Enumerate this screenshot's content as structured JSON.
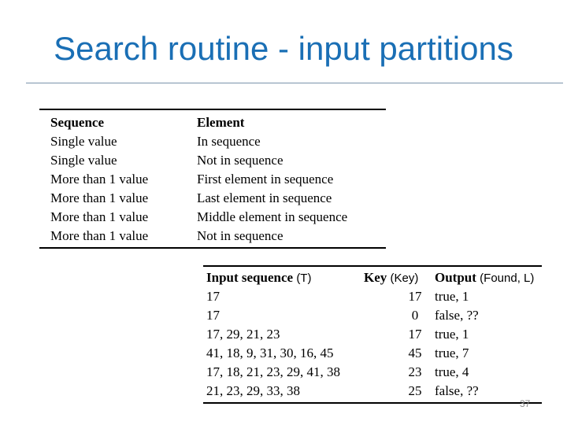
{
  "slide": {
    "title": "Search routine - input partitions",
    "page_number": "37"
  },
  "partitions_table": {
    "headers": [
      "Sequence",
      "Element"
    ],
    "rows": [
      [
        "Single value",
        "In sequence"
      ],
      [
        "Single value",
        "Not in sequence"
      ],
      [
        "More than 1 value",
        "First element in sequence"
      ],
      [
        "More than 1 value",
        "Last element in sequence"
      ],
      [
        "More than 1 value",
        "Middle element in sequence"
      ],
      [
        "More than 1 value",
        "Not in sequence"
      ]
    ]
  },
  "test_table": {
    "headers": [
      {
        "label": "Input sequence",
        "param": "(T)"
      },
      {
        "label": "Key",
        "param": "(Key)"
      },
      {
        "label": "Output",
        "param": "(Found, L)"
      }
    ],
    "rows": [
      [
        "17",
        "17",
        "true, 1"
      ],
      [
        "17",
        "0",
        "false, ??"
      ],
      [
        "17, 29, 21, 23",
        "17",
        "true, 1"
      ],
      [
        "41, 18, 9, 31, 30, 16, 45",
        "45",
        "true, 7"
      ],
      [
        "17, 18, 21, 23, 29, 41, 38",
        "23",
        "true, 4"
      ],
      [
        "21, 23, 29, 33, 38",
        "25",
        "false, ??"
      ]
    ]
  },
  "colors": {
    "title": "#1a6fb5",
    "rule": "#7a93ab",
    "page_number": "#8a8a8a"
  }
}
